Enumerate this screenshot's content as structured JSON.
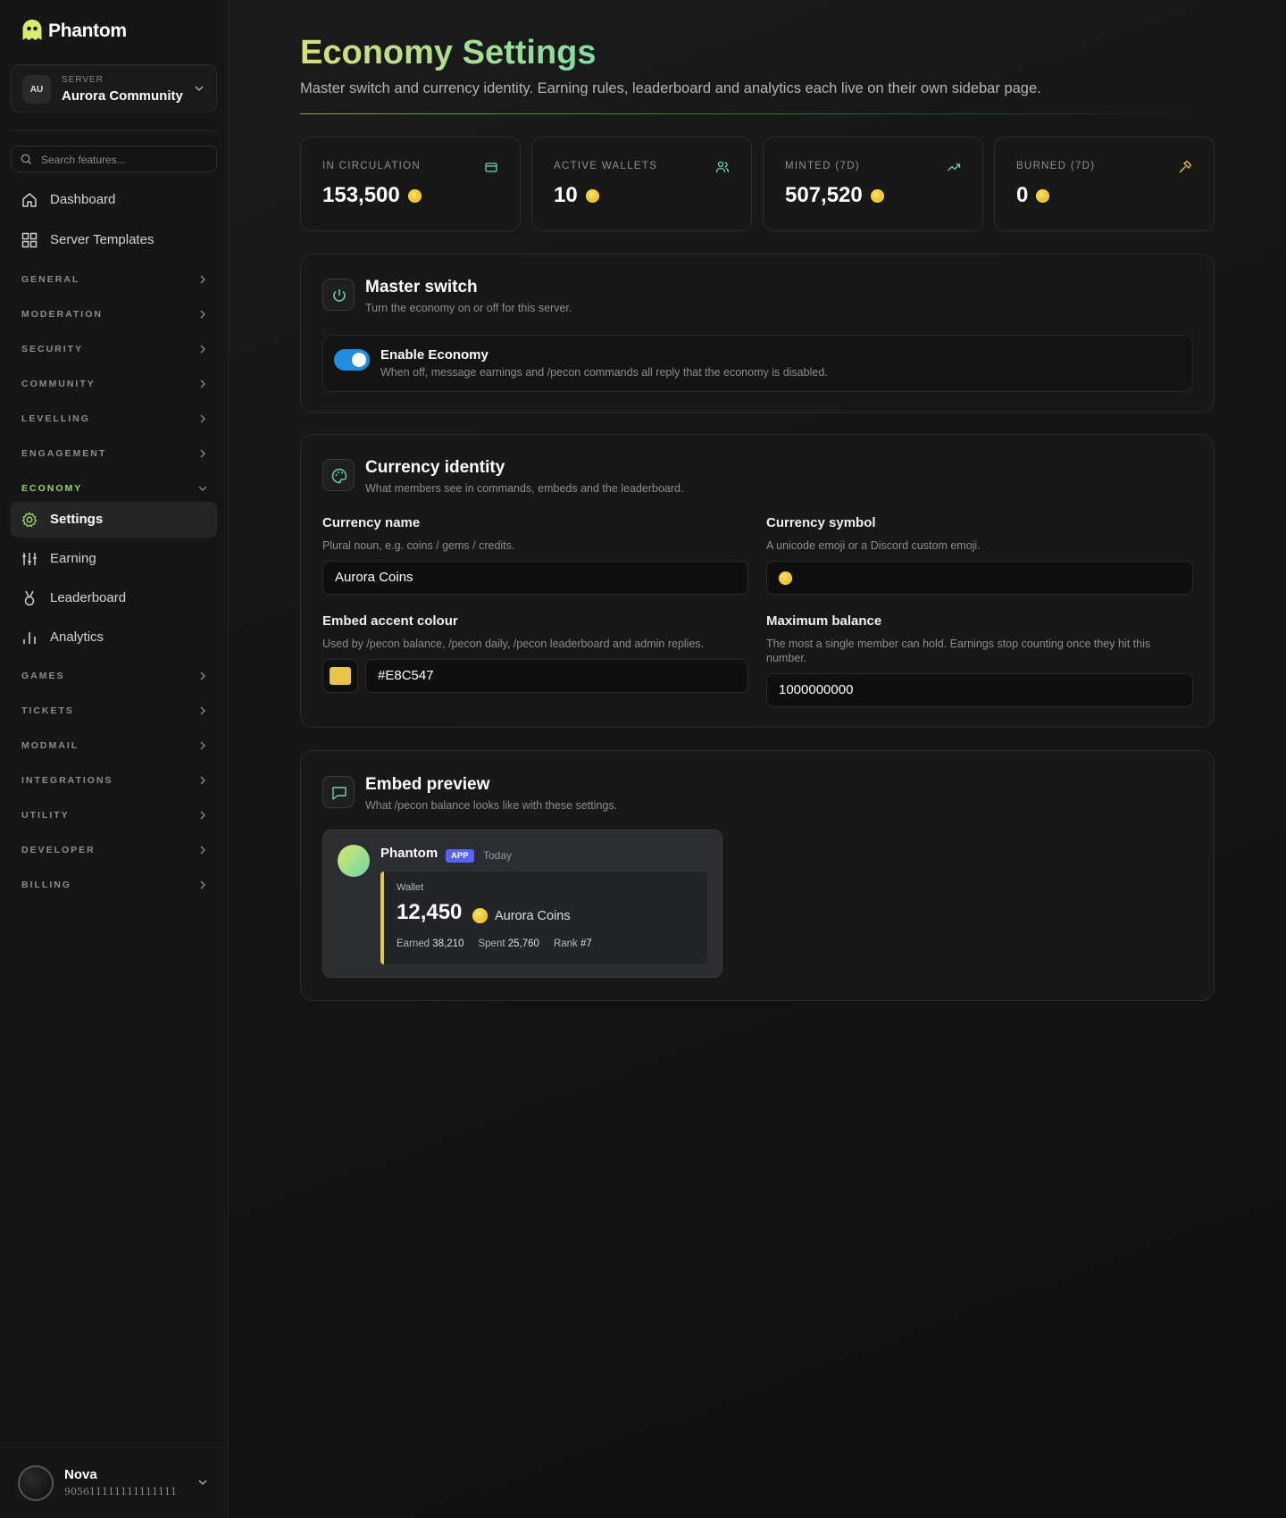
{
  "brand": {
    "name": "Phantom"
  },
  "server": {
    "caption": "SERVER",
    "avatar": "AU",
    "name": "Aurora Community"
  },
  "search": {
    "placeholder": "Search features..."
  },
  "nav": {
    "top": [
      {
        "label": "Dashboard",
        "icon": "home-icon"
      },
      {
        "label": "Server Templates",
        "icon": "grid-icon"
      }
    ],
    "sections": [
      {
        "label": "GENERAL"
      },
      {
        "label": "MODERATION"
      },
      {
        "label": "SECURITY"
      },
      {
        "label": "COMMUNITY"
      },
      {
        "label": "LEVELLING"
      },
      {
        "label": "ENGAGEMENT"
      },
      {
        "label": "ECONOMY",
        "open": true
      },
      {
        "label": "GAMES"
      },
      {
        "label": "TICKETS"
      },
      {
        "label": "MODMAIL"
      },
      {
        "label": "INTEGRATIONS"
      },
      {
        "label": "UTILITY"
      },
      {
        "label": "DEVELOPER"
      },
      {
        "label": "BILLING"
      }
    ],
    "economy_items": [
      {
        "label": "Settings",
        "icon": "gear-icon",
        "active": true
      },
      {
        "label": "Earning",
        "icon": "sliders-icon"
      },
      {
        "label": "Leaderboard",
        "icon": "medal-icon"
      },
      {
        "label": "Analytics",
        "icon": "bar-chart-icon"
      }
    ]
  },
  "user": {
    "name": "Nova",
    "id": "905611111111111111"
  },
  "page": {
    "title": "Economy Settings",
    "subtitle": "Master switch and currency identity. Earning rules, leaderboard and analytics each live on their own sidebar page."
  },
  "stats": [
    {
      "label": "IN CIRCULATION",
      "value": "153,500",
      "icon": "wallet-icon"
    },
    {
      "label": "ACTIVE WALLETS",
      "value": "10",
      "icon": "users-icon"
    },
    {
      "label": "MINTED (7D)",
      "value": "507,520",
      "icon": "trending-up-icon"
    },
    {
      "label": "BURNED (7D)",
      "value": "0",
      "icon": "hammer-icon"
    }
  ],
  "master": {
    "title": "Master switch",
    "subtitle": "Turn the economy on or off for this server.",
    "toggle_title": "Enable Economy",
    "toggle_desc": "When off, message earnings and /pecon commands all reply that the economy is disabled.",
    "enabled": true
  },
  "identity": {
    "title": "Currency identity",
    "subtitle": "What members see in commands, embeds and the leaderboard.",
    "name_label": "Currency name",
    "name_help": "Plural noun, e.g. coins / gems / credits.",
    "name_value": "Aurora Coins",
    "symbol_label": "Currency symbol",
    "symbol_help": "A unicode emoji or a Discord custom emoji.",
    "accent_label": "Embed accent colour",
    "accent_help": "Used by /pecon balance, /pecon daily, /pecon leaderboard and admin replies.",
    "accent_value": "#E8C547",
    "max_label": "Maximum balance",
    "max_help": "The most a single member can hold. Earnings stop counting once they hit this number.",
    "max_value": "1000000000"
  },
  "preview": {
    "title": "Embed preview",
    "subtitle": "What /pecon balance looks like with these settings.",
    "bot_name": "Phantom",
    "badge": "APP",
    "time": "Today",
    "caption": "Wallet",
    "balance": "12,450",
    "currency": "Aurora Coins",
    "earned_label": "Earned",
    "earned": "38,210",
    "spent_label": "Spent",
    "spent": "25,760",
    "rank_label": "Rank",
    "rank": "#7"
  },
  "colors": {
    "accent": "#E8C547",
    "toggle_on": "#1E8FE0",
    "brand_green": "#9AD66B",
    "discord_blurple": "#5865F2"
  }
}
